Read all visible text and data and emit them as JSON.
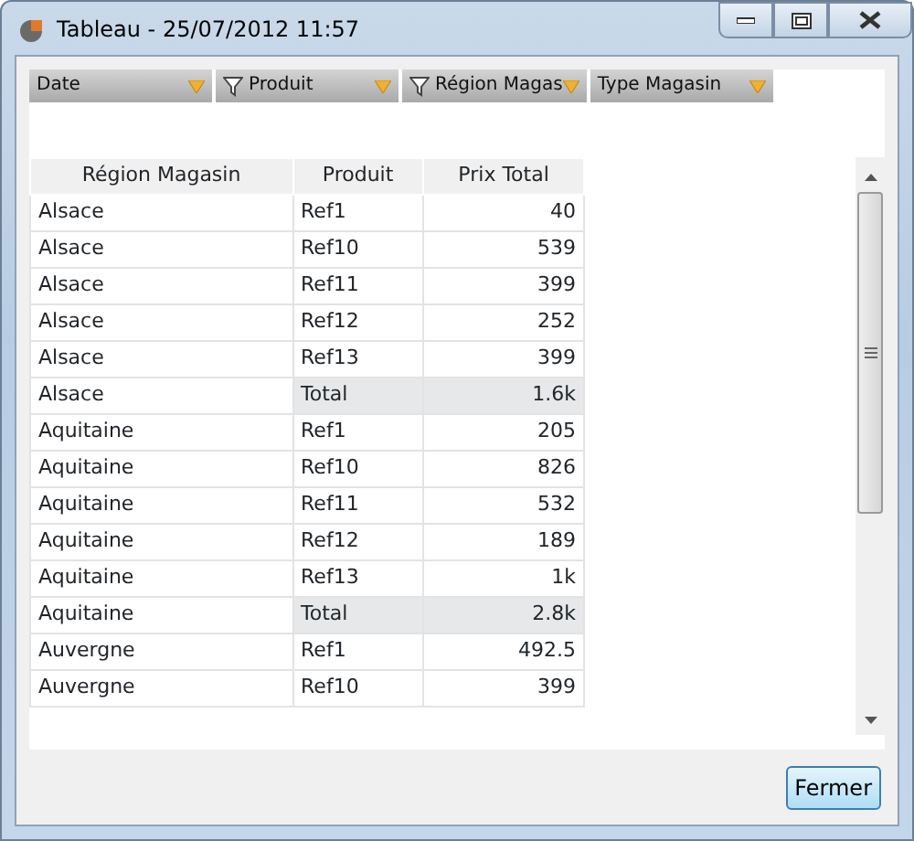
{
  "window": {
    "title": "Tableau - 25/07/2012 11:57"
  },
  "filters": [
    {
      "label": "Date",
      "filtered": false
    },
    {
      "label": "Produit",
      "filtered": true
    },
    {
      "label": "Région Magas",
      "filtered": true
    },
    {
      "label": "Type Magasin",
      "filtered": false
    }
  ],
  "table": {
    "columns": [
      "Région Magasin",
      "Produit",
      "Prix Total"
    ],
    "rows": [
      {
        "kind": "data",
        "cells": [
          "Alsace",
          "Ref1",
          "40"
        ]
      },
      {
        "kind": "data",
        "cells": [
          "Alsace",
          "Ref10",
          "539"
        ]
      },
      {
        "kind": "data",
        "cells": [
          "Alsace",
          "Ref11",
          "399"
        ]
      },
      {
        "kind": "data",
        "cells": [
          "Alsace",
          "Ref12",
          "252"
        ]
      },
      {
        "kind": "data",
        "cells": [
          "Alsace",
          "Ref13",
          "399"
        ]
      },
      {
        "kind": "total",
        "cells": [
          "Alsace",
          "Total",
          "1.6k"
        ]
      },
      {
        "kind": "data",
        "cells": [
          "Aquitaine",
          "Ref1",
          "205"
        ]
      },
      {
        "kind": "data",
        "cells": [
          "Aquitaine",
          "Ref10",
          "826"
        ]
      },
      {
        "kind": "data",
        "cells": [
          "Aquitaine",
          "Ref11",
          "532"
        ]
      },
      {
        "kind": "data",
        "cells": [
          "Aquitaine",
          "Ref12",
          "189"
        ]
      },
      {
        "kind": "data",
        "cells": [
          "Aquitaine",
          "Ref13",
          "1k"
        ]
      },
      {
        "kind": "total",
        "cells": [
          "Aquitaine",
          "Total",
          "2.8k"
        ]
      },
      {
        "kind": "data",
        "cells": [
          "Auvergne",
          "Ref1",
          "492.5"
        ]
      },
      {
        "kind": "data",
        "cells": [
          "Auvergne",
          "Ref10",
          "399"
        ]
      }
    ]
  },
  "buttons": [
    {
      "label": "Fermer"
    }
  ]
}
